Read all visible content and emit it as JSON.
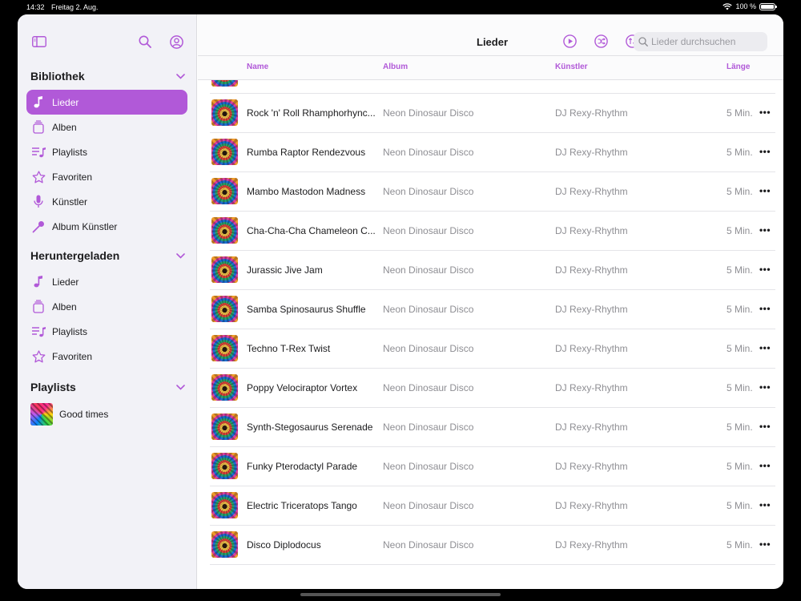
{
  "statusbar": {
    "time": "14:32",
    "date": "Freitag 2. Aug.",
    "battery": "100 %"
  },
  "sidebar": {
    "sections": [
      {
        "title": "Bibliothek",
        "items": [
          {
            "label": "Lieder",
            "icon": "music-note-icon",
            "active": true
          },
          {
            "label": "Alben",
            "icon": "album-stack-icon"
          },
          {
            "label": "Playlists",
            "icon": "playlist-icon"
          },
          {
            "label": "Favoriten",
            "icon": "star-icon"
          },
          {
            "label": "Künstler",
            "icon": "microphone-icon"
          },
          {
            "label": "Album Künstler",
            "icon": "mic-stand-icon"
          }
        ]
      },
      {
        "title": "Heruntergeladen",
        "items": [
          {
            "label": "Lieder",
            "icon": "music-note-icon"
          },
          {
            "label": "Alben",
            "icon": "album-stack-icon"
          },
          {
            "label": "Playlists",
            "icon": "playlist-icon"
          },
          {
            "label": "Favoriten",
            "icon": "star-icon"
          }
        ]
      },
      {
        "title": "Playlists",
        "items": [
          {
            "label": "Good times",
            "icon": "playlist-artwork"
          }
        ]
      }
    ]
  },
  "toolbar": {
    "title": "Lieder",
    "search_placeholder": "Lieder durchsuchen"
  },
  "columns": {
    "name": "Name",
    "album": "Album",
    "artist": "Künstler",
    "length": "Länge"
  },
  "songs": [
    {
      "name": "Rock 'n' Roll Rhamphorhync...",
      "album": "Neon Dinosaur Disco",
      "artist": "DJ Rexy-Rhythm",
      "length": "5 Min."
    },
    {
      "name": "Rumba Raptor Rendezvous",
      "album": "Neon Dinosaur Disco",
      "artist": "DJ Rexy-Rhythm",
      "length": "5 Min."
    },
    {
      "name": "Mambo Mastodon Madness",
      "album": "Neon Dinosaur Disco",
      "artist": "DJ Rexy-Rhythm",
      "length": "5 Min."
    },
    {
      "name": "Cha-Cha-Cha Chameleon C...",
      "album": "Neon Dinosaur Disco",
      "artist": "DJ Rexy-Rhythm",
      "length": "5 Min."
    },
    {
      "name": "Jurassic Jive Jam",
      "album": "Neon Dinosaur Disco",
      "artist": "DJ Rexy-Rhythm",
      "length": "5 Min."
    },
    {
      "name": "Samba Spinosaurus Shuffle",
      "album": "Neon Dinosaur Disco",
      "artist": "DJ Rexy-Rhythm",
      "length": "5 Min."
    },
    {
      "name": "Techno T-Rex Twist",
      "album": "Neon Dinosaur Disco",
      "artist": "DJ Rexy-Rhythm",
      "length": "5 Min."
    },
    {
      "name": "Poppy Velociraptor Vortex",
      "album": "Neon Dinosaur Disco",
      "artist": "DJ Rexy-Rhythm",
      "length": "5 Min."
    },
    {
      "name": "Synth-Stegosaurus Serenade",
      "album": "Neon Dinosaur Disco",
      "artist": "DJ Rexy-Rhythm",
      "length": "5 Min."
    },
    {
      "name": "Funky Pterodactyl Parade",
      "album": "Neon Dinosaur Disco",
      "artist": "DJ Rexy-Rhythm",
      "length": "5 Min."
    },
    {
      "name": "Electric Triceratops Tango",
      "album": "Neon Dinosaur Disco",
      "artist": "DJ Rexy-Rhythm",
      "length": "5 Min."
    },
    {
      "name": "Disco Diplodocus",
      "album": "Neon Dinosaur Disco",
      "artist": "DJ Rexy-Rhythm",
      "length": "5 Min."
    }
  ],
  "colors": {
    "accent": "#b159d8",
    "secondary_text": "#8e8e93",
    "sidebar_bg": "#f2f2f7"
  }
}
